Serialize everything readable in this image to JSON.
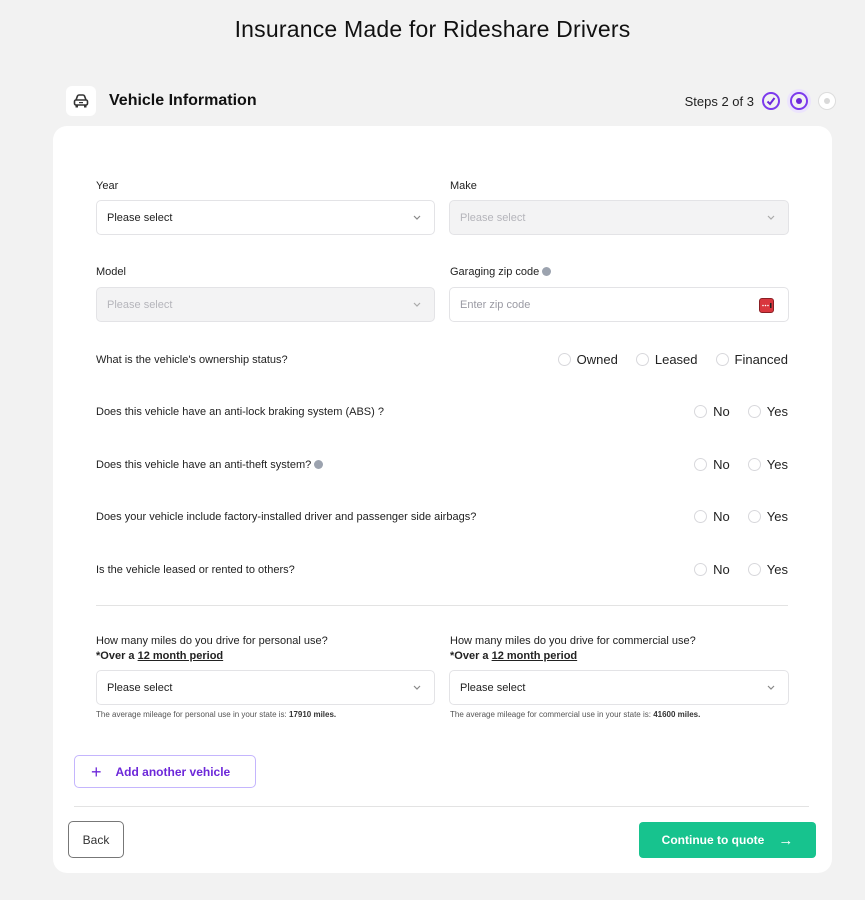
{
  "page": {
    "title": "Insurance Made for Rideshare Drivers"
  },
  "section": {
    "icon": "car-icon",
    "title": "Vehicle Information",
    "steps_label": "Steps 2 of 3",
    "steps": [
      {
        "state": "completed",
        "icon": "check-circle-icon"
      },
      {
        "state": "current",
        "icon": "radio-dot-icon"
      },
      {
        "state": "pending",
        "icon": "radio-dot-icon"
      }
    ]
  },
  "fields": {
    "year": {
      "label": "Year",
      "value": "Please select",
      "disabled": false
    },
    "make": {
      "label": "Make",
      "value": "Please select",
      "disabled": true
    },
    "model": {
      "label": "Model",
      "value": "Please select",
      "disabled": true
    },
    "zip": {
      "label": "Garaging zip code",
      "placeholder": "Enter zip code",
      "value": "",
      "info_icon": "info-icon",
      "trailing_icon": "keyboard-icon"
    }
  },
  "questions": [
    {
      "text": "What is the vehicle's ownership status?",
      "options": [
        "Owned",
        "Leased",
        "Financed"
      ]
    },
    {
      "text": "Does this vehicle have an anti-lock braking system (ABS) ?",
      "options": [
        "No",
        "Yes"
      ]
    },
    {
      "text": "Does this vehicle have an anti-theft system?",
      "options": [
        "No",
        "Yes"
      ],
      "info_icon": true
    },
    {
      "text": "Does your vehicle include factory-installed driver and passenger side airbags?",
      "options": [
        "No",
        "Yes"
      ]
    },
    {
      "text": "Is the vehicle leased or rented to others?",
      "options": [
        "No",
        "Yes"
      ]
    }
  ],
  "mileage": {
    "personal": {
      "question": "How many miles do you drive for personal use?",
      "sub_prefix": "*Over a ",
      "sub_link": "12 month period",
      "value": "Please select",
      "note_prefix": "The average mileage for personal use in your state is: ",
      "note_value": "17910 miles."
    },
    "commercial": {
      "question": "How many miles do you drive for commercial use?",
      "sub_prefix": "*Over a ",
      "sub_link": "12 month period",
      "value": "Please select",
      "note_prefix": "The average mileage for commercial use in your state is: ",
      "note_value": "41600 miles."
    }
  },
  "actions": {
    "add_vehicle": "Add another vehicle",
    "back": "Back",
    "continue": "Continue to quote"
  },
  "colors": {
    "accent_purple": "#7c3aed",
    "primary_green": "#17c38e",
    "background": "#f2f2f2"
  }
}
